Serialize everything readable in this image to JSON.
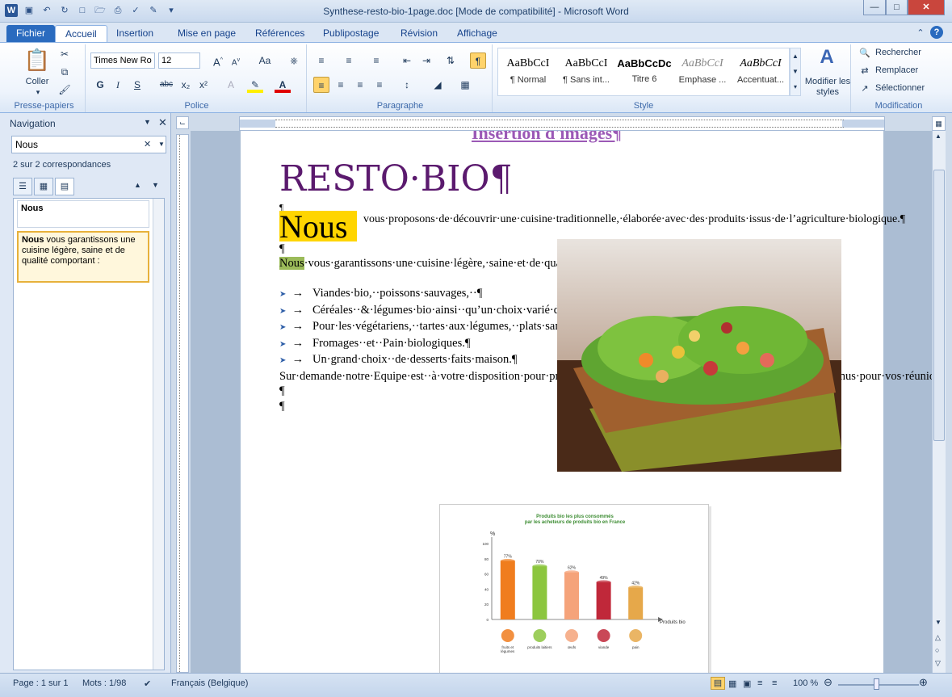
{
  "window": {
    "title": "Synthese-resto-bio-1page.doc [Mode de compatibilité] - Microsoft Word",
    "app_icon": "W"
  },
  "tabs": [
    "Fichier",
    "Accueil",
    "Insertion",
    "Mise en page",
    "Références",
    "Publipostage",
    "Révision",
    "Affichage"
  ],
  "ribbon": {
    "clipboard": {
      "label": "Presse-papiers",
      "paste": "Coller"
    },
    "font": {
      "label": "Police",
      "name": "Times New Ro",
      "size": "12",
      "bold": "G",
      "italic": "I",
      "underline": "S",
      "strike": "abc",
      "sub": "x₂",
      "sup": "x²",
      "case": "Aa"
    },
    "paragraph": {
      "label": "Paragraphe"
    },
    "styles": {
      "label": "Style",
      "items": [
        {
          "sample": "AaBbCcI",
          "name": "¶ Normal"
        },
        {
          "sample": "AaBbCcI",
          "name": "¶ Sans int..."
        },
        {
          "sample": "AaBbCcDc",
          "name": "Titre 6"
        },
        {
          "sample": "AaBbCcI",
          "name": "Emphase ..."
        },
        {
          "sample": "AaBbCcI",
          "name": "Accentuat..."
        }
      ],
      "modify": "Modifier les styles"
    },
    "editing": {
      "label": "Modification",
      "find": "Rechercher",
      "replace": "Remplacer",
      "select": "Sélectionner"
    }
  },
  "nav": {
    "title": "Navigation",
    "search": "Nous",
    "count": "2 sur 2 correspondances",
    "results": [
      {
        "bold": "Nous",
        "rest": ""
      },
      {
        "bold": "Nous",
        "rest": " vous garantissons une cuisine légère, saine et de qualité comportant :"
      }
    ]
  },
  "document": {
    "heading_top": "Insertion d'images¶",
    "title": "RESTO·BIO¶",
    "pilcrow": "¶",
    "dropcap": "Nous",
    "intro": "vous·proposons·de·découvrir·une·cuisine·traditionnelle,·élaborée·avec·des·produits·issus·de·l’agriculture·biologique.¶",
    "para1_hl": "Nous",
    "para1": "·vous·garantissons·une·cuisine·légère,·saine·et·de·qualité··comportant··:¶",
    "bullets": [
      "Viandes·bio,··poissons·sauvages,··¶",
      "Céréales··&·légumes·bio·ainsi··qu’un·choix·varié·de·Crudités·de·saison.¶",
      "Pour·les·végétariens,··tartes·aux·légumes,··plats·sans·protéines·animales··et·salades·variées.¶",
      "Fromages··et··Pain·biologiques.¶",
      "Un·grand·choix··de·desserts·faits·maison.¶"
    ],
    "closing": "Sur·demande·notre·Equipe·est··à·votre·disposition·pour·préparer··selon·vos·envies,··toute·une·gamme·de·plats·et·menus·pour·vos·réunions,··banquet,··fêtes·de·famille,··etc...¶"
  },
  "chart_data": {
    "type": "bar",
    "title": "Produits bio les plus consommés par les acheteurs de produits bio en France",
    "ylabel": "%",
    "xlabel": "Produits bio",
    "categories": [
      "fruits et légumes",
      "produits laitiers",
      "œufs",
      "viande",
      "pain"
    ],
    "values": [
      77,
      70,
      62,
      49,
      42
    ],
    "value_labels": [
      "77%",
      "70%",
      "62%",
      "49%",
      "42%"
    ],
    "ylim": [
      0,
      100
    ],
    "yticks": [
      "0",
      "20",
      "40",
      "60",
      "80",
      "100"
    ],
    "colors": [
      "#f07d1e",
      "#8cc63f",
      "#f5a37a",
      "#c0283a",
      "#e6a84a"
    ]
  },
  "status": {
    "page": "Page : 1 sur 1",
    "words": "Mots : 1/98",
    "language": "Français (Belgique)",
    "zoom": "100 %"
  }
}
